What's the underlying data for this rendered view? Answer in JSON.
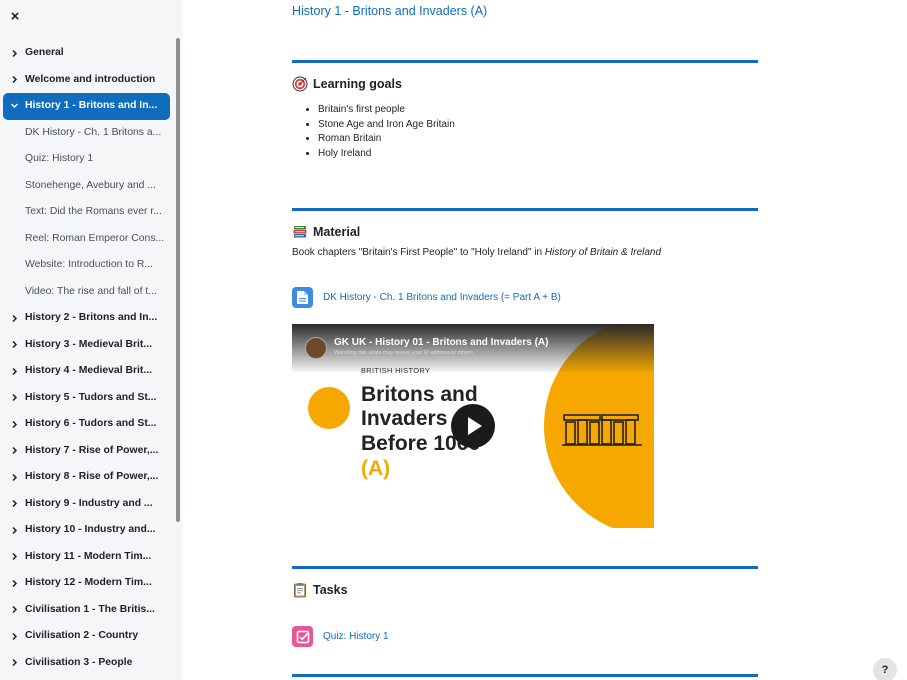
{
  "sidebar": {
    "close_label": "×",
    "items": [
      {
        "label": "General",
        "type": "section"
      },
      {
        "label": "Welcome and introduction",
        "type": "section"
      },
      {
        "label": "History 1 - Britons and In...",
        "type": "section",
        "active": true
      },
      {
        "label": "DK History - Ch. 1 Britons a...",
        "type": "activity"
      },
      {
        "label": "Quiz: History 1",
        "type": "activity"
      },
      {
        "label": "Stonehenge, Avebury and ...",
        "type": "activity"
      },
      {
        "label": "Text: Did the Romans ever r...",
        "type": "activity"
      },
      {
        "label": "Reel: Roman Emperor Cons...",
        "type": "activity"
      },
      {
        "label": "Website: Introduction to R...",
        "type": "activity"
      },
      {
        "label": "Video: The rise and fall of t...",
        "type": "activity"
      },
      {
        "label": "History 2 - Britons and In...",
        "type": "section"
      },
      {
        "label": "History 3 - Medieval Brit...",
        "type": "section"
      },
      {
        "label": "History 4 - Medieval Brit...",
        "type": "section"
      },
      {
        "label": "History 5 - Tudors and St...",
        "type": "section"
      },
      {
        "label": "History 6 - Tudors and St...",
        "type": "section"
      },
      {
        "label": "History 7 - Rise of Power,...",
        "type": "section"
      },
      {
        "label": "History 8 - Rise of Power,...",
        "type": "section"
      },
      {
        "label": "History 9 - Industry and ...",
        "type": "section"
      },
      {
        "label": "History 10 - Industry and...",
        "type": "section"
      },
      {
        "label": "History 11 - Modern Tim...",
        "type": "section"
      },
      {
        "label": "History 12 - Modern Tim...",
        "type": "section"
      },
      {
        "label": "Civilisation 1 - The Britis...",
        "type": "section"
      },
      {
        "label": "Civilisation 2 - Country",
        "type": "section"
      },
      {
        "label": "Civilisation 3 - People",
        "type": "section"
      }
    ]
  },
  "main": {
    "page_title_link": "History 1 - Britons and Invaders (A)",
    "learning_goals": {
      "heading": "Learning goals",
      "items": [
        "Britain's first people",
        "Stone Age and Iron Age Britain",
        "Roman Britain",
        "Holy Ireland"
      ]
    },
    "material": {
      "heading": "Material",
      "text_before": "Book chapters \"Britain's First People\" to \"Holy Ireland\" in ",
      "text_italic": "History of Britain & Ireland",
      "resource_link": "DK History - Ch. 1 Britons and Invaders (= Part A + B)",
      "video": {
        "title": "GK UK - History 01 - Britons and Invaders (A)",
        "warning": "Watching this video may reveal your IP address to others.",
        "kicker": "BRITISH HISTORY",
        "line1": "Britons and",
        "line2": "Invaders",
        "line3": "Before 1066",
        "line4": "(A)"
      }
    },
    "tasks": {
      "heading": "Tasks",
      "quiz_link": "Quiz: History 1"
    }
  },
  "help_label": "?",
  "colors": {
    "accent": "#0f6cbf",
    "sidebar_bg": "#f5f6f8",
    "video_accent": "#f7a800",
    "quiz_icon": "#e8569a",
    "resource_icon": "#3d8be2"
  }
}
